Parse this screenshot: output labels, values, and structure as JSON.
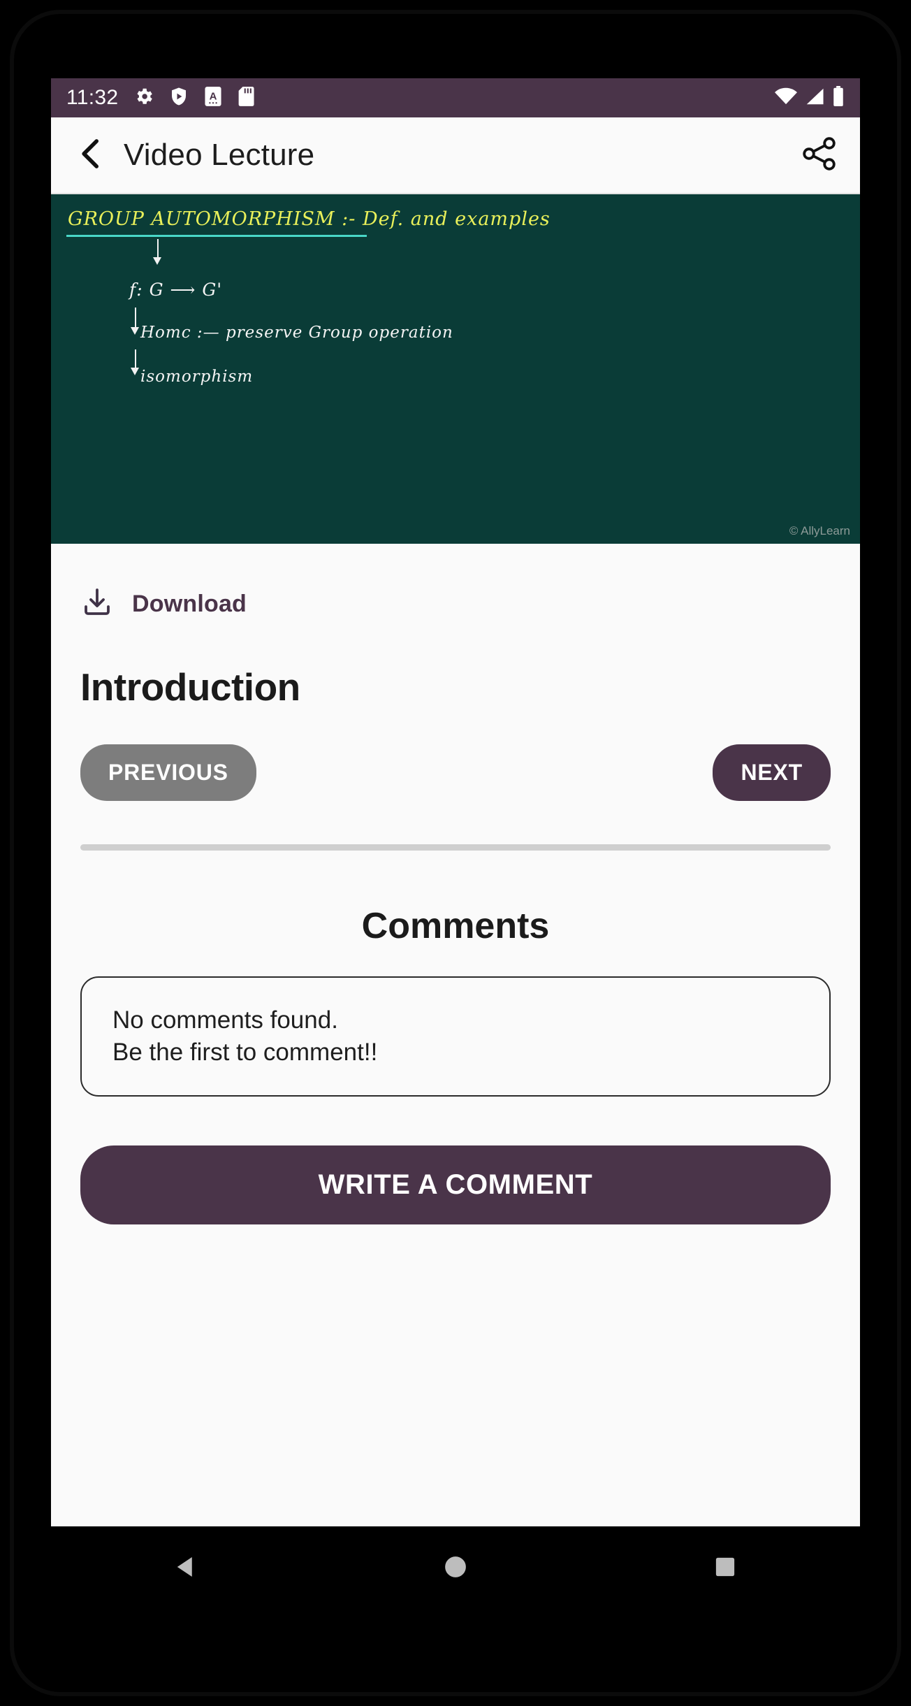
{
  "status_bar": {
    "time": "11:32",
    "left_icons": [
      "gear-icon",
      "play-shield-icon",
      "translate-icon",
      "sd-card-icon"
    ],
    "right_icons": [
      "wifi-icon",
      "cellular-signal-icon",
      "battery-icon"
    ],
    "background_color": "#4a3449"
  },
  "app_bar": {
    "back_icon": "chevron-left-icon",
    "title": "Video Lecture",
    "share_icon": "share-icon"
  },
  "video": {
    "board_color": "#0a3c37",
    "title_text": "GROUP AUTOMORPHISM :- Def. and examples",
    "line1": "f:  G ⟶  G'",
    "line2": "Homc :—  preserve  Group  operation",
    "line3": "isomorphism",
    "watermark": "© AllyLearn"
  },
  "main": {
    "download_icon": "download-icon",
    "download_label": "Download",
    "lesson_title": "Introduction",
    "previous_label": "PREVIOUS",
    "next_label": "NEXT",
    "previous_color": "#7d7d7d",
    "next_color": "#4a3449",
    "comments_heading": "Comments",
    "comments_empty_line1": "No comments found.",
    "comments_empty_line2": "Be the first to comment!!",
    "write_comment_label": "WRITE A COMMENT"
  },
  "nav_bar": {
    "back_icon": "triangle-back-icon",
    "home_icon": "circle-home-icon",
    "recents_icon": "square-recents-icon"
  }
}
